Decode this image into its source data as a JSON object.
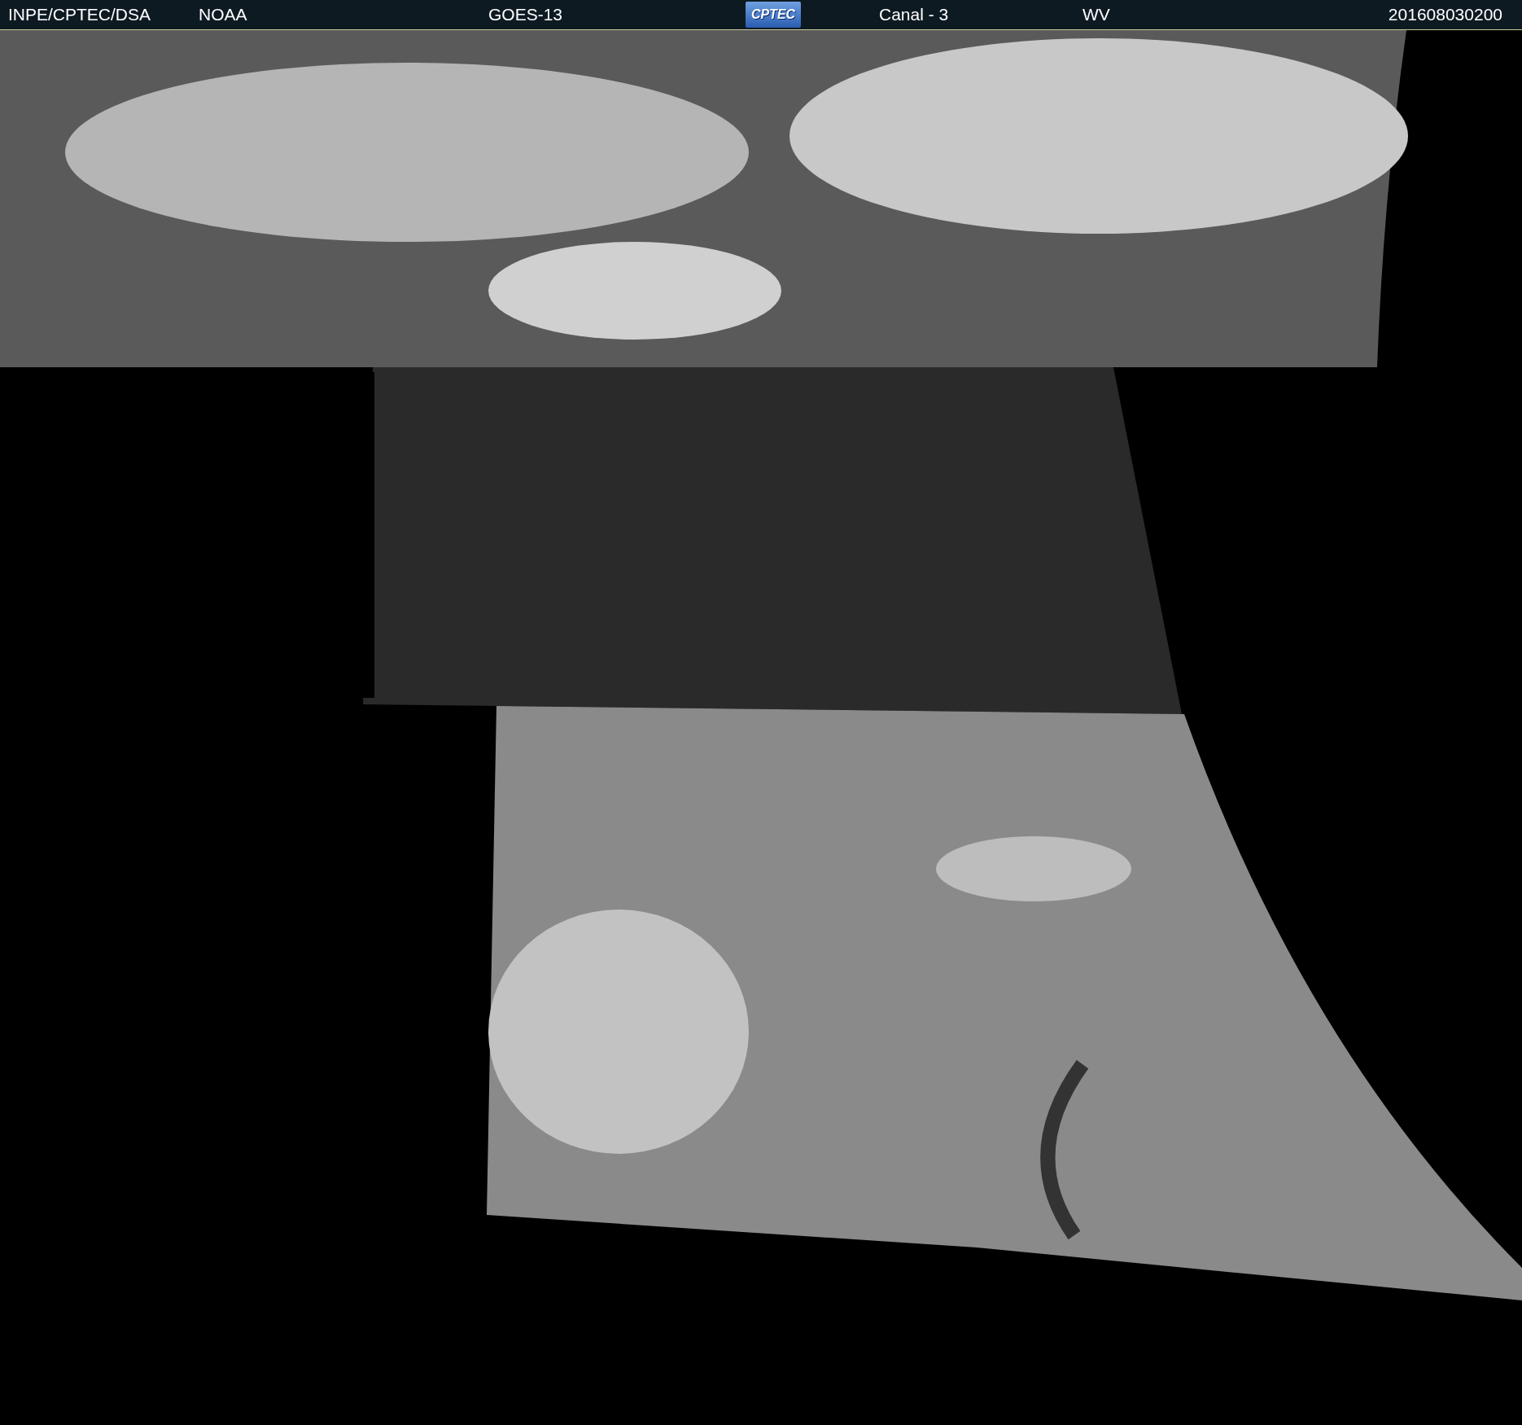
{
  "header": {
    "source": "INPE/CPTEC/DSA",
    "agency": "NOAA",
    "satellite": "GOES-13",
    "logo": "CPTEC",
    "channel": "Canal - 3",
    "band": "WV",
    "timestamp": "201608030200"
  }
}
